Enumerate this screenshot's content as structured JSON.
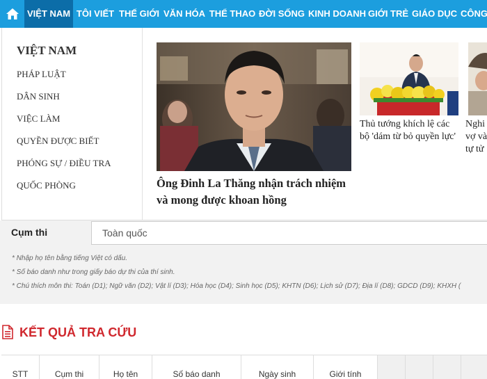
{
  "nav": {
    "items": [
      {
        "label": "VIỆT NAM"
      },
      {
        "label": "TÔI VIẾT"
      },
      {
        "label": "THẾ GIỚI"
      },
      {
        "label": "VĂN HÓA"
      },
      {
        "label": "THỂ THAO"
      },
      {
        "label": "ĐỜI SỐNG"
      },
      {
        "label": "KINH DOANH"
      },
      {
        "label": "GIỚI TRẺ"
      },
      {
        "label": "GIÁO DỤC"
      },
      {
        "label": "CÔNG"
      }
    ],
    "home_icon": "home-icon",
    "bar_color": "#1c9ede",
    "active_color": "#0c6da8"
  },
  "menu": {
    "title": "VIỆT NAM",
    "links": [
      "PHÁP LUẬT",
      "DÂN SINH",
      "VIỆC LÀM",
      "QUYỀN ĐƯỢC BIẾT",
      "PHÓNG SỰ / ĐIỀU TRA",
      "QUỐC PHÒNG"
    ],
    "stories": {
      "main": {
        "title": "Ông Đinh La Thăng nhận trách nhiệm và mong được khoan hồng"
      },
      "second": {
        "title": "Thủ tướng khích lệ các bộ 'dám từ bỏ quyền lực'"
      },
      "third": {
        "title": "Nghi\nvợ và\ntự tử"
      }
    }
  },
  "form": {
    "cum_label": "Cụm thi",
    "cum_value": "Toàn quốc",
    "notes": [
      "* Nhập họ tên bằng tiếng Việt có dấu.",
      "* Số báo danh như trong giấy báo dự thi của thí sinh.",
      "* Chú thích môn thi: Toán (D1); Ngữ văn (D2); Vật lí (D3); Hóa học (D4); Sinh học (D5); KHTN (D6); Lịch sử (D7); Địa lí (D8); GDCD (D9); KHXH ("
    ]
  },
  "results": {
    "title": "KẾT QUẢ TRA CỨU",
    "icon": "document-icon",
    "accent": "#d0282e",
    "columns": [
      "STT",
      "Cụm thi",
      "Họ tên",
      "Số báo danh",
      "Ngày sinh",
      "Giới tính",
      "",
      "",
      "",
      ""
    ]
  }
}
